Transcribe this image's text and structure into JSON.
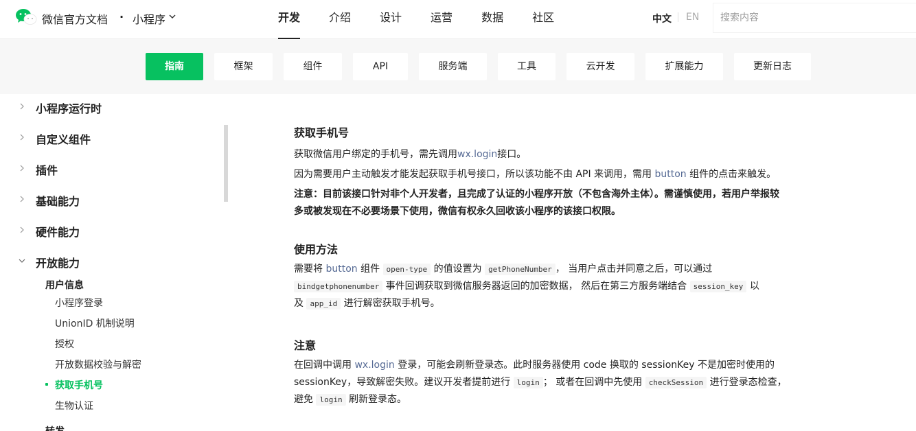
{
  "header": {
    "brand": "微信官方文档",
    "dot": "·",
    "product": "小程序",
    "nav": [
      "开发",
      "介绍",
      "设计",
      "运营",
      "数据",
      "社区"
    ],
    "lang_zh": "中文",
    "lang_en": "EN",
    "search_placeholder": "搜索内容"
  },
  "subnav": [
    "指南",
    "框架",
    "组件",
    "API",
    "服务端",
    "工具",
    "云开发",
    "扩展能力",
    "更新日志"
  ],
  "sidebar": {
    "items": [
      "小程序运行时",
      "自定义组件",
      "插件",
      "基础能力",
      "硬件能力",
      "开放能力"
    ],
    "group": "用户信息",
    "leaves": [
      "小程序登录",
      "UnionID 机制说明",
      "授权",
      "开放数据校验与解密",
      "获取手机号",
      "生物认证"
    ],
    "cut_item": "转发"
  },
  "content": {
    "title": "获取手机号",
    "p1_pre": "获取微信用户绑定的手机号，需先调用",
    "p1_link": "wx.login",
    "p1_post": "接口。",
    "p2_pre": "因为需要用户主动触发才能发起获取手机号接口，所以该功能不由 API 来调用，需用 ",
    "p2_link": "button",
    "p2_post": " 组件的点击来触发。",
    "note": "注意：目前该接口针对非个人开发者，且完成了认证的小程序开放（不包含海外主体）。需谨慎使用，若用户举报较多或被发现在不必要场景下使用，微信有权永久回收该小程序的该接口权限。",
    "usage_title": "使用方法",
    "u_1": "需要将 ",
    "u_link": "button",
    "u_2": " 组件 ",
    "u_code1": "open-type",
    "u_3": " 的值设置为 ",
    "u_code2": "getPhoneNumber",
    "u_4": "， 当用户点击并同意之后，可以通过 ",
    "u_code3": "bindgetphonenumber",
    "u_5": " 事件回调获取到微信服务器返回的加密数据， 然后在第三方服务端结合 ",
    "u_code4": "session_key",
    "u_6": " 以及 ",
    "u_code5": "app_id",
    "u_7": " 进行解密获取手机号。",
    "note_title": "注意",
    "n_1": "在回调中调用 ",
    "n_link": "wx.login",
    "n_2": " 登录，可能会刷新登录态。此时服务器使用 code 换取的 sessionKey 不是加密时使用的 sessionKey，导致解密失败。建议开发者提前进行 ",
    "n_code1": "login",
    "n_3": "； 或者在回调中先使用 ",
    "n_code2": "checkSession",
    "n_4": " 进行登录态检查，避免 ",
    "n_code3": "login",
    "n_5": " 刷新登录态。"
  },
  "colors": {
    "accent": "#07c160",
    "link": "#576b95"
  }
}
